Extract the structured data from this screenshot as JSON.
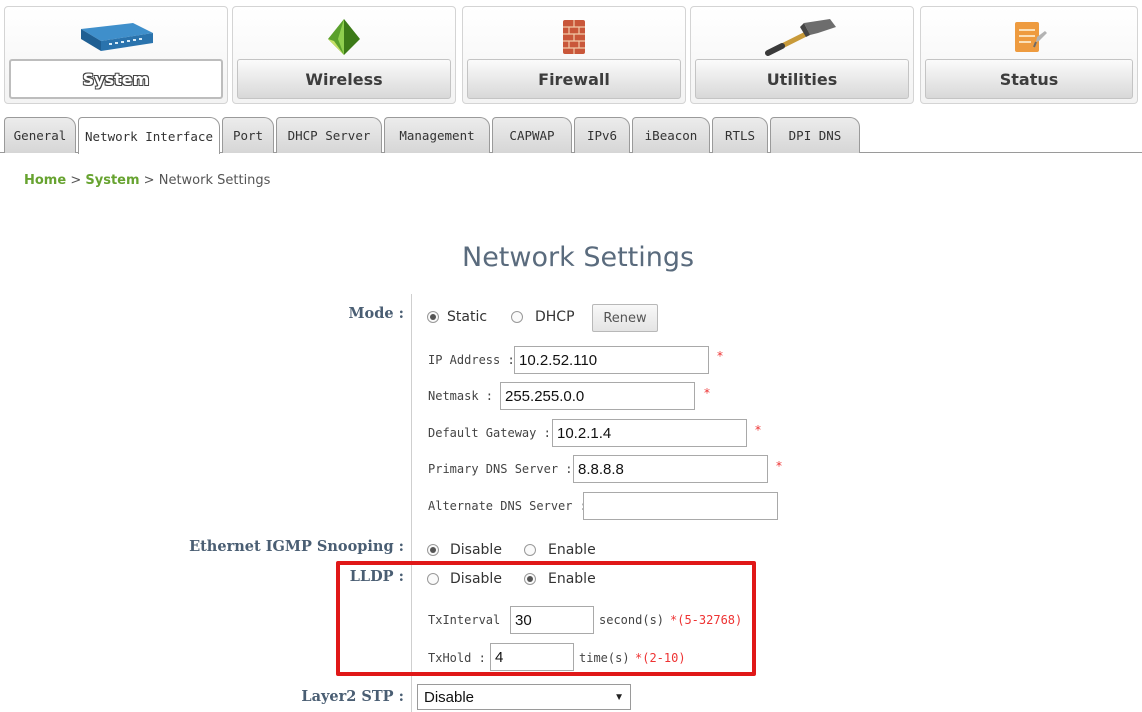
{
  "top_nav": {
    "tabs": [
      {
        "label": "System",
        "icon": "network-switch-icon",
        "active": true
      },
      {
        "label": "Wireless",
        "icon": "green-pyramid-icon",
        "active": false
      },
      {
        "label": "Firewall",
        "icon": "brick-wall-icon",
        "active": false
      },
      {
        "label": "Utilities",
        "icon": "hammer-icon",
        "active": false
      },
      {
        "label": "Status",
        "icon": "clipboard-icon",
        "active": false
      }
    ]
  },
  "sub_tabs": [
    "General",
    "Network Interface",
    "Port",
    "DHCP Server",
    "Management",
    "CAPWAP",
    "IPv6",
    "iBeacon",
    "RTLS",
    "DPI DNS"
  ],
  "sub_tab_active": "Network Interface",
  "breadcrumb": {
    "home": "Home",
    "sep": ">",
    "system": "System",
    "current": "Network Settings"
  },
  "page_title": "Network Settings",
  "form": {
    "mode": {
      "label": "Mode :",
      "options": [
        "Static",
        "DHCP"
      ],
      "selected": "Static",
      "renew_label": "Renew"
    },
    "ip_address": {
      "label": "IP Address :",
      "value": "10.2.52.110",
      "required": "*"
    },
    "netmask": {
      "label": "Netmask :",
      "value": "255.255.0.0",
      "required": "*"
    },
    "default_gateway": {
      "label": "Default Gateway :",
      "value": "10.2.1.4",
      "required": "*"
    },
    "primary_dns": {
      "label": "Primary DNS Server :",
      "value": "8.8.8.8",
      "required": "*"
    },
    "alternate_dns": {
      "label": "Alternate DNS Server :",
      "value": ""
    },
    "igmp": {
      "label": "Ethernet IGMP Snooping :",
      "options": [
        "Disable",
        "Enable"
      ],
      "selected": "Disable"
    },
    "lldp": {
      "label": "LLDP :",
      "options": [
        "Disable",
        "Enable"
      ],
      "selected": "Enable"
    },
    "tx_interval": {
      "label": "TxInterval :",
      "value": "30",
      "unit": "second(s)",
      "range": "*(5-32768)"
    },
    "tx_hold": {
      "label": "TxHold :",
      "value": "4",
      "unit": "time(s)",
      "range": "*(2-10)"
    },
    "layer2_stp": {
      "label": "Layer2 STP :",
      "value": "Disable"
    }
  },
  "colors": {
    "highlight_box": "#e01818",
    "breadcrumb_link": "#67a330",
    "required": "#e33333",
    "title": "#5a6b7d"
  }
}
